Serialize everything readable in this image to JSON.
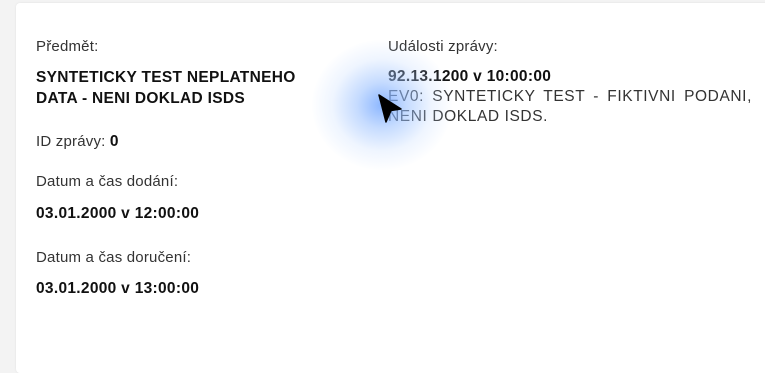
{
  "message": {
    "subject_label": "Předmět:",
    "subject_value": "SYNTETICKY TEST NEPLATNEHO DATA - NENI DOKLAD ISDS",
    "id_label": "ID zprávy:",
    "id_value": "0",
    "delivered_label": "Datum a čas dodání:",
    "delivered_value": "03.01.2000 v 12:00:00",
    "receipt_label": "Datum a čas doručení:",
    "receipt_value": "03.01.2000 v 13:00:00"
  },
  "events": {
    "label": "Události zprávy:",
    "date": "92.13.1200 v 10:00:00",
    "text": "EV0: SYNTETICKY TEST - FIKTIVNI PODANI, NENI DOKLAD ISDS."
  },
  "colors": {
    "background": "#f3f3f3",
    "card": "#ffffff",
    "text": "#222222",
    "cursor_highlight": "#78aaff"
  },
  "icons": {
    "cursor": "mouse-pointer-icon"
  }
}
